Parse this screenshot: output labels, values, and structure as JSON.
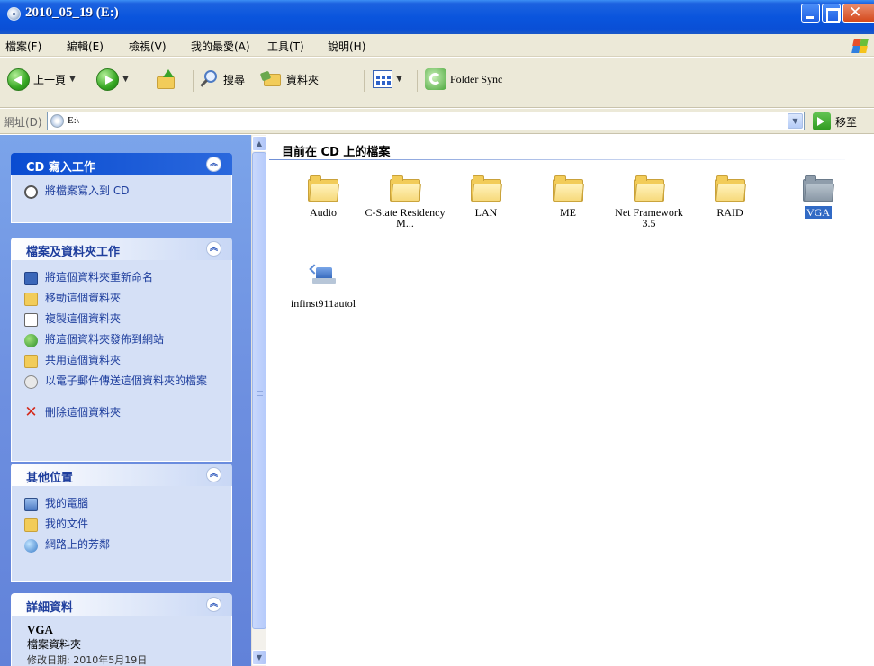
{
  "window": {
    "title": "2010_05_19 (E:)"
  },
  "menu": [
    "檔案(F)",
    "編輯(E)",
    "檢視(V)",
    "我的最愛(A)",
    "工具(T)",
    "說明(H)"
  ],
  "toolbar": {
    "back_label": "上一頁",
    "search_label": "搜尋",
    "folders_label": "資料夾",
    "foldersync_label": "Folder Sync"
  },
  "address": {
    "label": "網址(D)",
    "value": "E:\\",
    "go_label": "移至"
  },
  "tasks": {
    "cd": {
      "title": "CD 寫入工作",
      "items": [
        "將檔案寫入到 CD"
      ]
    },
    "file": {
      "title": "檔案及資料夾工作",
      "items": [
        "將這個資料夾重新命名",
        "移動這個資料夾",
        "複製這個資料夾",
        "將這個資料夾發佈到網站",
        "共用這個資料夾",
        "以電子郵件傳送這個資料夾的檔案",
        "刪除這個資料夾"
      ]
    },
    "places": {
      "title": "其他位置",
      "items": [
        "我的電腦",
        "我的文件",
        "網路上的芳鄰"
      ]
    },
    "details": {
      "title": "詳細資料",
      "name": "VGA",
      "type": "檔案資料夾",
      "date": "修改日期: 2010年5月19日"
    }
  },
  "main": {
    "group_title": "目前在 CD 上的檔案",
    "files": [
      {
        "name": "Audio",
        "type": "folder"
      },
      {
        "name": "C-State Residency M...",
        "type": "folder"
      },
      {
        "name": "LAN",
        "type": "folder"
      },
      {
        "name": "ME",
        "type": "folder"
      },
      {
        "name": "Net Framework 3.5",
        "type": "folder"
      },
      {
        "name": "RAID",
        "type": "folder"
      },
      {
        "name": "VGA",
        "type": "folder",
        "selected": true
      },
      {
        "name": "infinst911autol",
        "type": "setup"
      }
    ]
  },
  "colors": {
    "titlebar": "#0a55dd",
    "task_pane": "#6d8fe0",
    "selection": "#316ac5",
    "folder": "#f2cc59"
  }
}
